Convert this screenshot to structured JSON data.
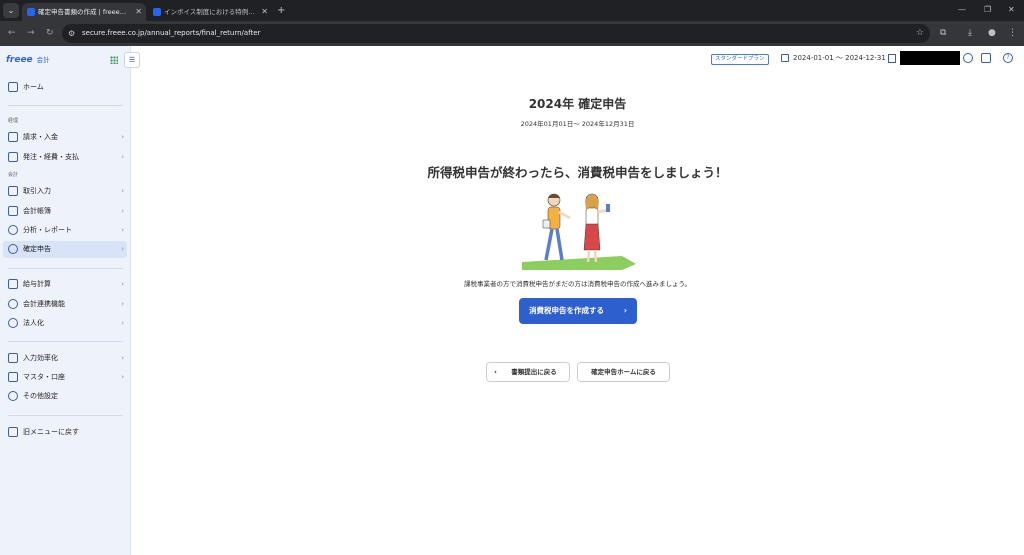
{
  "browser": {
    "tabs": [
      {
        "title": "確定申告書類の作成 | freee会計",
        "active": true
      },
      {
        "title": "インボイス制度における特例 – free",
        "active": false
      }
    ],
    "url": "secure.freee.co.jp/annual_reports/final_return/after"
  },
  "header": {
    "plan_badge": "スタンダードプラン",
    "period": "2024-01-01 〜 2024-12-31"
  },
  "sidebar": {
    "logo": "freee",
    "logo_sub": "会計",
    "home": "ホーム",
    "sections": {
      "keiri": "経理",
      "kaikei": "会計"
    },
    "items": [
      {
        "label": "請求・入金"
      },
      {
        "label": "発注・経費・支払"
      },
      {
        "label": "取引入力"
      },
      {
        "label": "会計帳簿"
      },
      {
        "label": "分析・レポート"
      },
      {
        "label": "確定申告"
      },
      {
        "label": "給与計算"
      },
      {
        "label": "会計連携機能"
      },
      {
        "label": "法人化"
      },
      {
        "label": "入力効率化"
      },
      {
        "label": "マスタ・口座"
      },
      {
        "label": "その他設定"
      }
    ],
    "old_menu": "旧メニューに戻す"
  },
  "main": {
    "title": "2024年 確定申告",
    "period": "2024年01月01日～ 2024年12月31日",
    "headline": "所得税申告が終わったら、消費税申告をしましょう！",
    "description": "課税事業者の方で消費税申告がまだの方は消費税申告の作成へ進みましょう。",
    "primary_button": "消費税申告を作成する",
    "back_button": "書類提出に戻る",
    "home_button": "確定申告ホームに戻る"
  }
}
